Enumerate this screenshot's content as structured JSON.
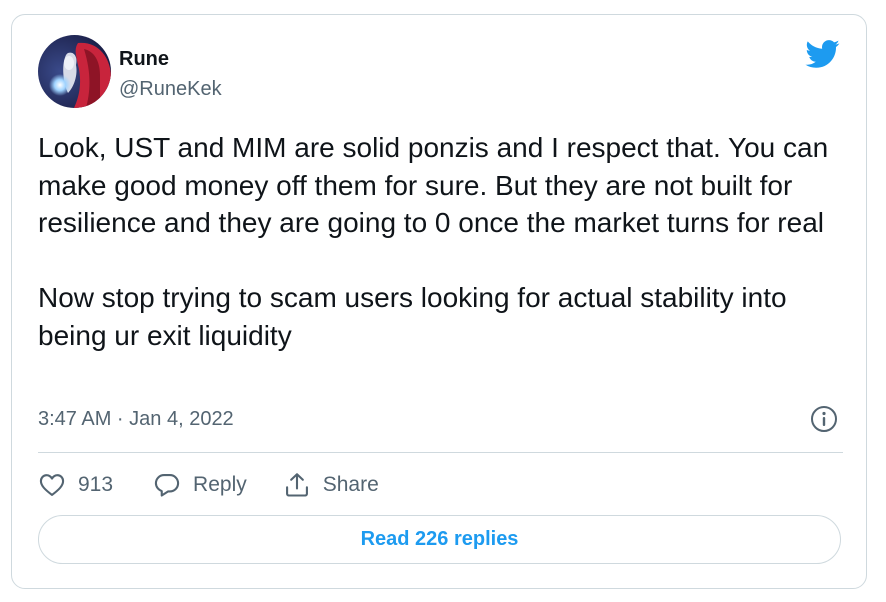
{
  "tweet": {
    "author_name": "Rune",
    "author_handle": "@RuneKek",
    "text_paragraph_1": "Look, UST and MIM are solid ponzis and I respect that. You can make good money off them for sure. But they are not built for resilience and they are going to 0 once the market turns for real",
    "text_paragraph_2": "Now stop trying to scam users looking for actual stability into being ur exit liquidity",
    "timestamp": "3:47 AM · Jan 4, 2022"
  },
  "actions": {
    "likes_count": "913",
    "reply_label": "Reply",
    "share_label": "Share"
  },
  "read_replies_label": "Read 226 replies",
  "icons": {
    "brand": "twitter-bird-icon",
    "info": "info-icon",
    "like": "heart-icon",
    "reply": "reply-bubble-icon",
    "share": "share-icon"
  },
  "colors": {
    "brand_blue": "#1d9bf0",
    "text_primary": "#0f1419",
    "text_secondary": "#536471",
    "border": "#cfd9de"
  }
}
